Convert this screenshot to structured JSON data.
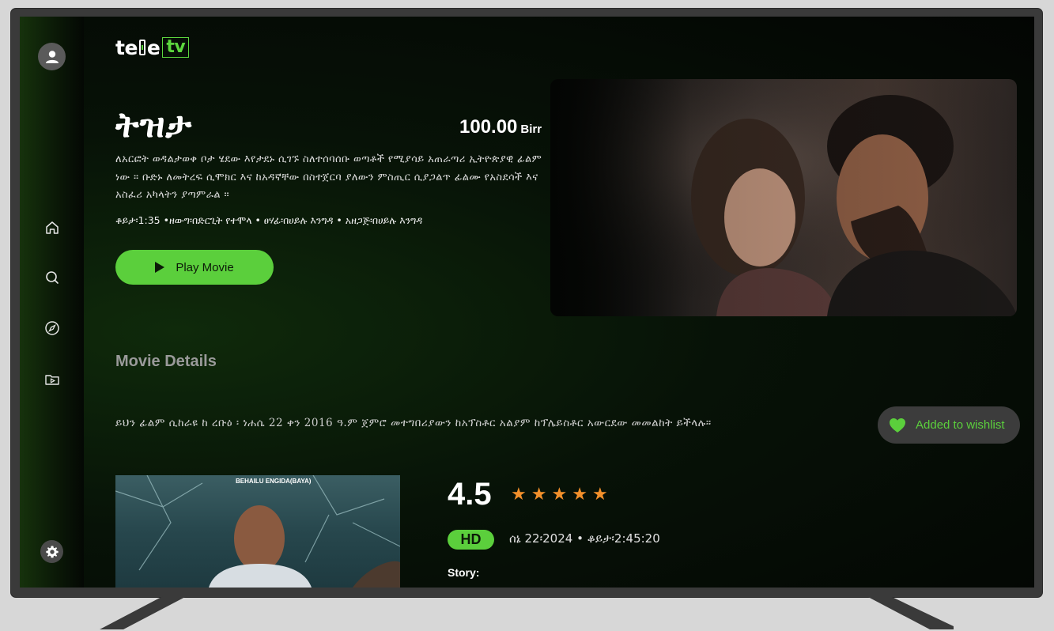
{
  "app": {
    "logo_text": "te",
    "logo_text_b": "e",
    "logo_tv": "tv"
  },
  "movie": {
    "title": "ትዝታ",
    "price_amount": "100.00",
    "price_currency": "Birr",
    "description": "ለአርፎት ወዳልታወቀ ቦታ ሄደው እየታደኑ ሲገኙ ስለተሰባሰቡ ወጣቶች የሚያሳይ አጠራጣሪ ኢትዮጵያዊ ፊልም ነው ። ቡድኑ ለመትረፍ ሲሞክር እና ከአዳኛቸው በስተጀርባ ያለውን ምስጢር ሲያጋልጥ ፊልሙ የአስደሳች እና አስፈሪ አካላትን ያጣምራል ።",
    "meta": "ቆይታ፡1:35 •ዘውግ፡በድርጊት የተሞላ •  ፀሃፊ፡በሀይሉ እንግዳ •  አዘጋጅ፡በሀይሉ እንግዳ",
    "play_label": "Play Movie"
  },
  "details": {
    "section_title": "Movie Details",
    "notice": "ይህን ፊልም ሲከራዩ ከ ረቡዕ ፡ ነሐሴ 22 ቀን 2016 ዓ.ም ጀምሮ መተግበሪያውን ከአፕስቶር አልያም ከፕሌይስቶር አውርደው መመልከት ይችላሉ።",
    "wishlist_label": "Added to wishlist",
    "rating": "4.5",
    "stars": 5,
    "quality": "HD",
    "info_line": "ሰኔ 22፡2024 • ቆይታ፡2:45:20",
    "story_label": "Story:",
    "poster_caption": "BEHAILU ENGIDA(BAYA)"
  },
  "colors": {
    "accent": "#5bcf3c",
    "star": "#f3902b"
  },
  "icons": {
    "avatar": "user-icon",
    "nav": [
      "home-icon",
      "search-icon",
      "compass-icon",
      "folder-play-icon"
    ],
    "settings": "gear-icon",
    "play": "play-icon",
    "wishlist": "heart-icon"
  }
}
